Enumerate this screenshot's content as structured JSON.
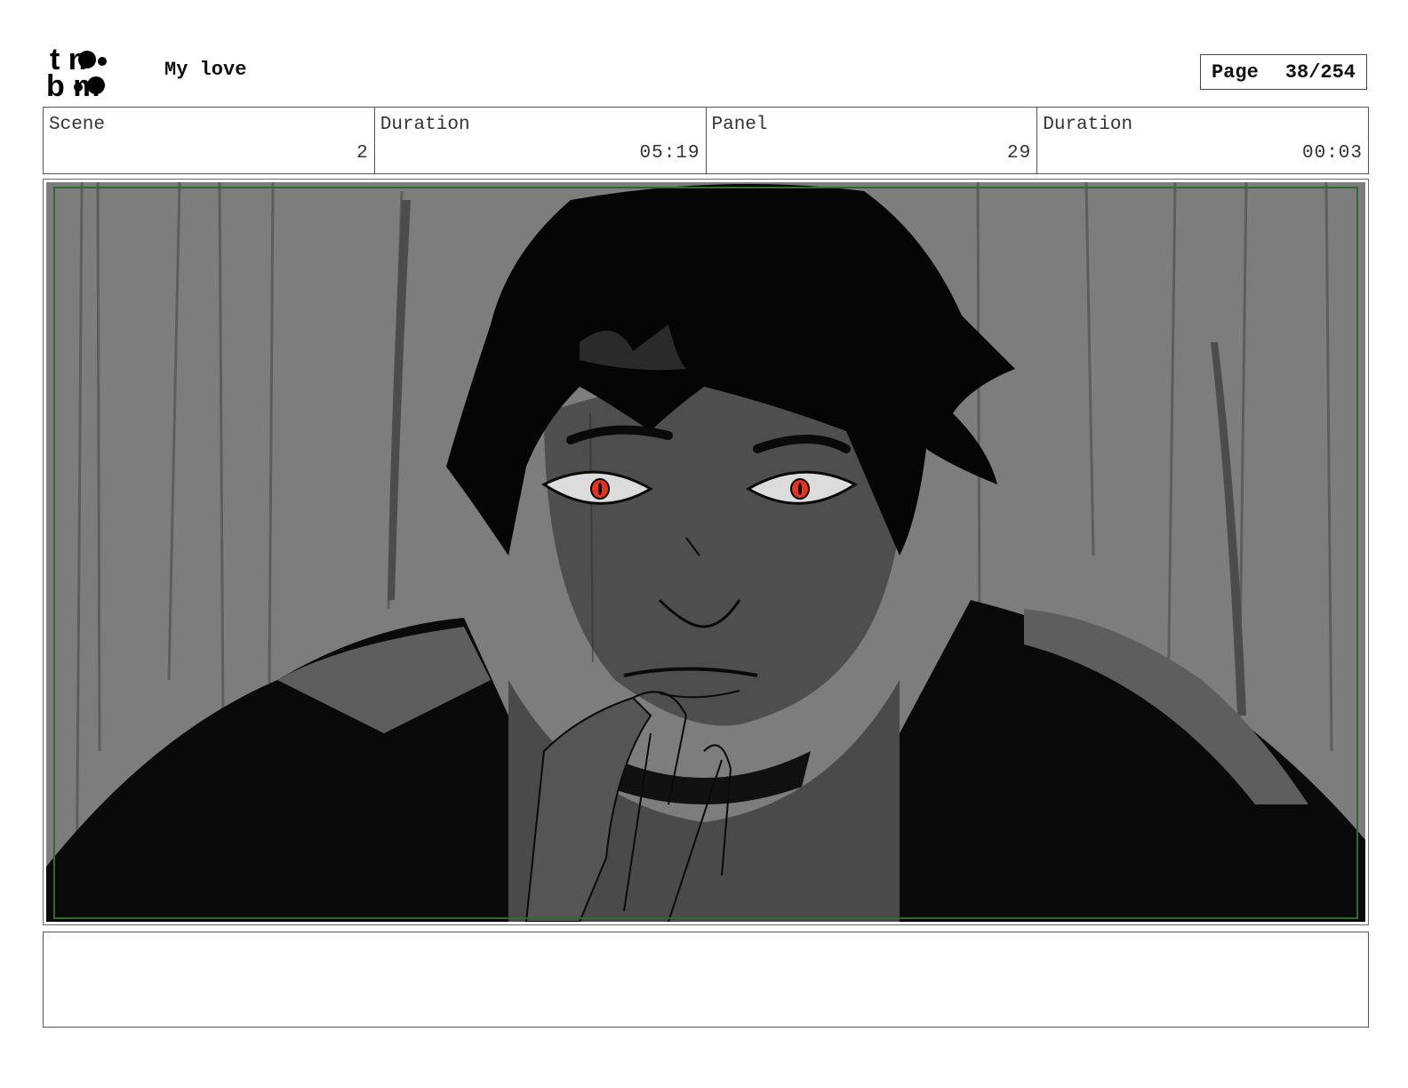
{
  "header": {
    "logo_top": "t n",
    "logo_bottom": "b m",
    "project_title": "My love",
    "page_label": "Page",
    "page_number": "38/254"
  },
  "info": {
    "scene_label": "Scene",
    "scene_value": "2",
    "scene_duration_label": "Duration",
    "scene_duration_value": "05:19",
    "panel_label": "Panel",
    "panel_value": "29",
    "panel_duration_label": "Duration",
    "panel_duration_value": "00:03"
  },
  "panel": {
    "frame_color": "#2f6b2f",
    "eye_color": "#e8321e"
  },
  "notes": {
    "text": ""
  }
}
